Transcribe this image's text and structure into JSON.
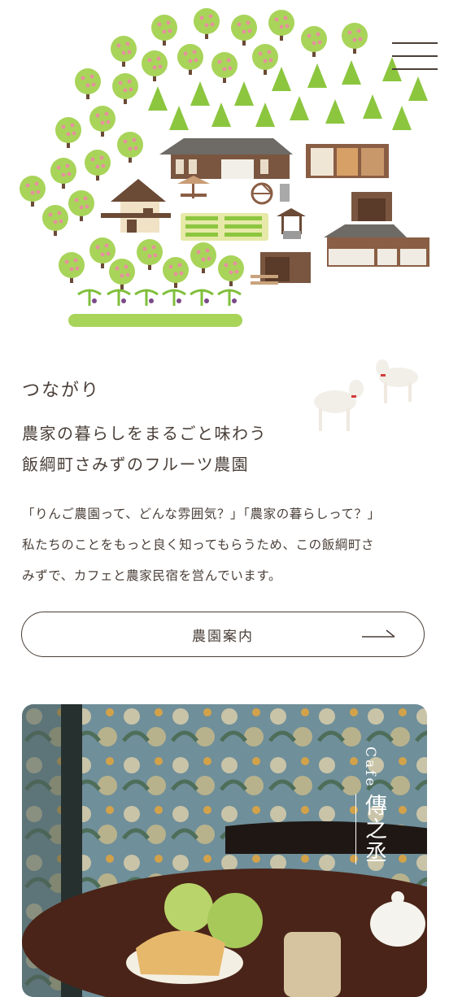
{
  "header": {
    "menu_icon": "hamburger-menu-icon"
  },
  "about": {
    "title": "つながり",
    "headline": [
      "農家の暮らしをまるごと味わう",
      "飯綱町さみずのフルーツ農園"
    ],
    "body": [
      "「りんご農園って、どんな雰囲気？」「農家の暮らしって？」",
      "私たちのことをもっと良く知ってもらうため、この飯綱町さ",
      "みずで、カフェと農家民宿を営んでいます。"
    ],
    "button_label": "農園案内",
    "button_icon": "arrow-right-icon"
  },
  "cafe": {
    "label_en": "Cafe",
    "label_jp": "傳之丞"
  },
  "colors": {
    "text": "#4a3f38",
    "tree_green": "#a8d45a",
    "apple_pink": "#e88fa0",
    "conifer_green": "#8cc63f",
    "roof_gray": "#6e6a66",
    "wood_brown": "#6b4a36"
  }
}
